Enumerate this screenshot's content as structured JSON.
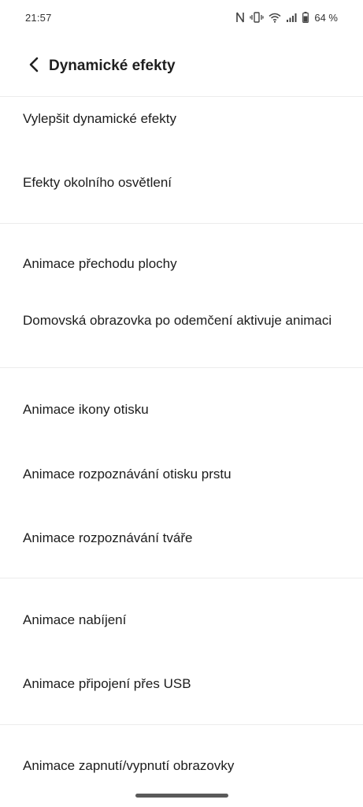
{
  "status_bar": {
    "time": "21:57",
    "icons": [
      "nfc-icon",
      "vibrate-icon",
      "wifi-icon",
      "signal-icon",
      "battery-icon"
    ],
    "battery": "64 %"
  },
  "header": {
    "back_icon": "chevron-left-icon",
    "title": "Dynamické efekty"
  },
  "items": [
    "Vylepšit dynamické efekty",
    "Efekty okolního osvětlení",
    "Animace přechodu plochy",
    "Domovská obrazovka po odemčení aktivuje animaci",
    "Animace ikony otisku",
    "Animace rozpoznávání otisku prstu",
    "Animace rozpoznávání tváře",
    "Animace nabíjení",
    "Animace připojení přes USB",
    "Animace zapnutí/vypnutí obrazovky"
  ]
}
